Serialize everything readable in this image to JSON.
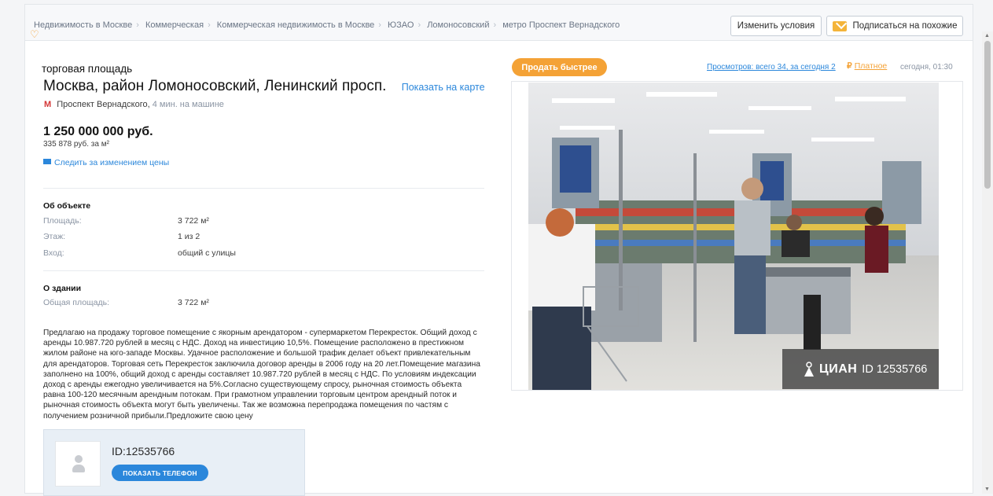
{
  "breadcrumbs": [
    "Недвижимость в Москве",
    "Коммерческая",
    "Коммерческая недвижимость в Москве",
    "ЮЗАО",
    "Ломоносовский",
    "метро Проспект Вернадского"
  ],
  "breadcrumb_separator": "›",
  "actions": {
    "change_conditions": "Изменить условия",
    "subscribe_similar": "Подписаться на похожие"
  },
  "listing": {
    "type": "торговая площадь",
    "address": "Москва, район Ломоносовский, Ленинский просп.",
    "show_on_map": "Показать на карте",
    "metro_station": "Проспект Вернадского,",
    "metro_distance": "4 мин. на машине",
    "price": "1 250 000 000 руб.",
    "price_per_m2": "335 878 руб. за м²",
    "watch_price": "Следить за изменением цены"
  },
  "about_object": {
    "title": "Об объекте",
    "rows": [
      {
        "key": "Площадь:",
        "value": "3 722 м²"
      },
      {
        "key": "Этаж:",
        "value": "1 из 2"
      },
      {
        "key": "Вход:",
        "value": "общий с улицы"
      }
    ]
  },
  "about_building": {
    "title": "О здании",
    "rows": [
      {
        "key": "Общая площадь:",
        "value": "3 722 м²"
      }
    ]
  },
  "description": "Предлагаю на продажу торговое помещение с якорным арендатором - супермаркетом Перекресток. Общий доход с аренды 10.987.720 рублей в месяц с НДС. Доход на инвестицию 10,5%. Помещение расположено в престижном жилом районе на юго-западе Москвы. Удачное расположение и большой трафик делает объект привлекательным для арендаторов. Торговая сеть Перекресток заключила договор аренды в 2006 году на 20 лет.Помещение магазина заполнено на 100%, общий доход с аренды составляет 10.987.720 рублей в месяц с НДС. По условиям индексации доход с аренды ежегодно увеличивается на 5%.Согласно существующему спросу, рыночная стоимость объекта равна 100-120 месячным арендным потокам. При грамотном управлении торговым центром арендный поток и рыночная стоимость объекта могут быть увеличены. Так же возможна перепродажа помещения по частям с получением розничной прибыли.Предложите свою цену",
  "contact": {
    "id": "ID:12535766",
    "show_phone": "ПОКАЗАТЬ ТЕЛЕФОН"
  },
  "sidebar": {
    "sell_faster": "Продать быстрее",
    "views": "Просмотров: всего 34, за сегодня 2",
    "paid_symbol": "₽",
    "paid_label": "Платное",
    "date": "сегодня, 01:30"
  },
  "photo": {
    "watermark_logo": "ЦИАН",
    "watermark_id": "ID 12535766"
  },
  "colors": {
    "link": "#2b87db",
    "accent": "#f4a236",
    "metro": "#d43636"
  }
}
